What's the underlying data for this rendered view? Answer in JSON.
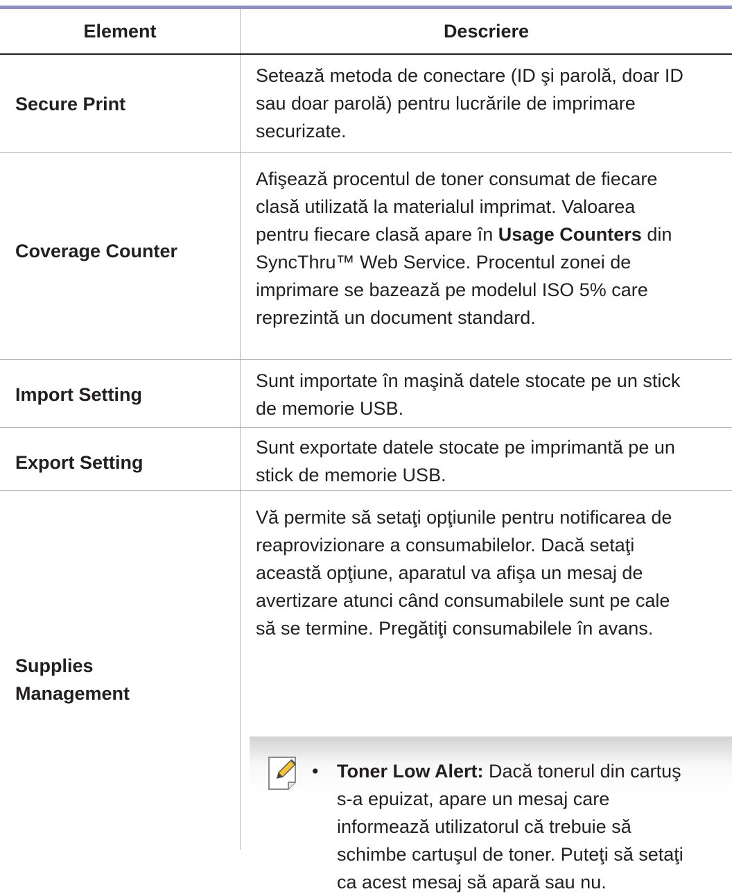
{
  "table": {
    "headers": {
      "element": "Element",
      "description": "Descriere"
    },
    "rows": [
      {
        "name": "Secure Print",
        "desc_lines": [
          "Setează metoda de conectare (ID şi parolă, doar ID",
          "sau doar parolă) pentru lucrările de imprimare",
          "securizate."
        ]
      },
      {
        "name": "Coverage Counter",
        "desc_lines": [
          "Afişează procentul de toner consumat de fiecare",
          "clasă utilizată la materialul imprimat. Valoarea",
          "pentru fiecare clasă apare în",
          "SyncThru™ Web Service. Procentul zonei de",
          "imprimare se bazează pe modelul ISO 5% care",
          "reprezintă un document standard."
        ],
        "line3_bold": "Usage Counters",
        "line3_tail": "din"
      },
      {
        "name": "Import Setting",
        "desc_lines": [
          "Sunt importate în maşină datele stocate pe un stick",
          "de memorie USB."
        ]
      },
      {
        "name": "Export Setting",
        "desc_lines": [
          "Sunt exportate datele stocate pe imprimantă pe un",
          "stick de memorie USB."
        ]
      },
      {
        "name_lines": [
          "Supplies",
          "Management"
        ],
        "desc_lines": [
          "Vă permite să setaţi opţiunile pentru notificarea de",
          "reaprovizionare a consumabilelor. Dacă setaţi",
          "această opţiune, aparatul va afişa un mesaj de",
          "avertizare atunci când consumabilele sunt pe cale",
          "să se termine. Pregătiţi consumabilele în avans."
        ],
        "note": {
          "icon": "note-pencil-icon",
          "bullet": "•",
          "bold_label": "Toner Low Alert:",
          "line1_tail": "Dacă tonerul din cartuş",
          "lines": [
            "s-a epuizat, apare un mesaj care",
            "informează utilizatorul că trebuie să",
            "schimbe cartuşul de toner. Puteţi să setaţi",
            "ca acest mesaj să apară sau nu."
          ]
        }
      }
    ]
  },
  "colors": {
    "top_rule": "#8f8fc1",
    "text": "#231f20",
    "divider": "#b5b5b5"
  }
}
